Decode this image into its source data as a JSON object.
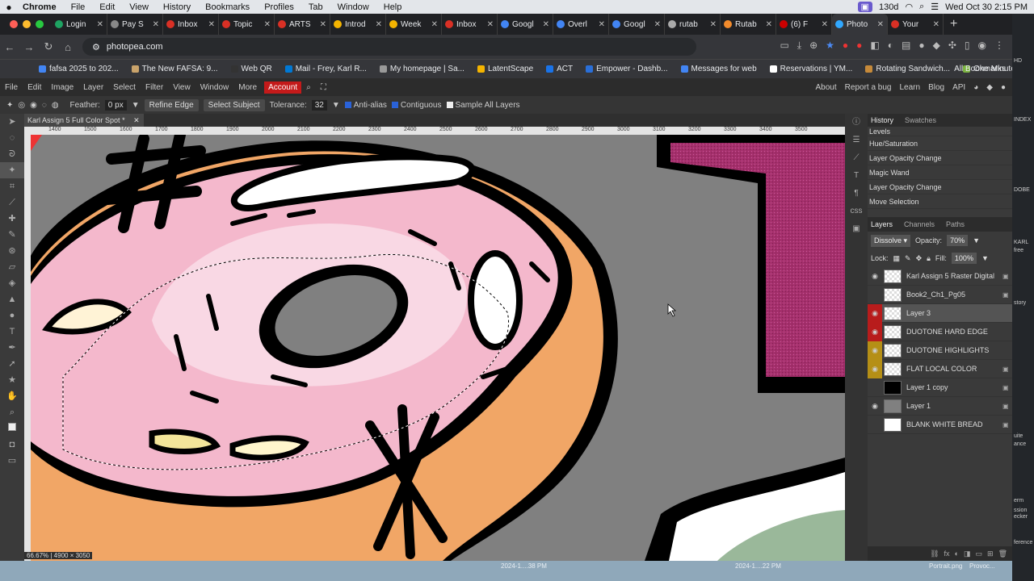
{
  "mac": {
    "apple": "",
    "app": "Chrome",
    "menus": [
      "File",
      "Edit",
      "View",
      "History",
      "Bookmarks",
      "Profiles",
      "Tab",
      "Window",
      "Help"
    ],
    "battery": "130d",
    "datetime": "Wed Oct 30  2:15 PM"
  },
  "tabs": [
    "Login",
    "Pay S",
    "Inbox",
    "Topic",
    "ARTS",
    "Introd",
    "Week",
    "Inbox",
    "Googl",
    "Overl",
    "Googl",
    "rutab",
    "Rutab",
    "(6) F",
    "Photo",
    "Your"
  ],
  "tab_colors": [
    "#1ea362",
    "#888",
    "#d93025",
    "#d93025",
    "#d93025",
    "#f4b400",
    "#f4b400",
    "#d93025",
    "#4285f4",
    "#4285f4",
    "#4285f4",
    "#aaa",
    "#f28b2c",
    "#cc0000",
    "#31a8ff",
    "#d93025"
  ],
  "url": "photopea.com",
  "bookmarks": [
    "fafsa 2025 to 202...",
    "The New FAFSA: 9...",
    "Web QR",
    "Mail - Frey, Karl R...",
    "My homepage | Sa...",
    "LatentScape",
    "ACT",
    "Empower - Dashb...",
    "Messages for web",
    "Reservations | YM...",
    "Rotating Sandwich...",
    "One Minute Park"
  ],
  "all_bookmarks": "All Bookmarks",
  "photopea": {
    "menu": [
      "File",
      "Edit",
      "Image",
      "Layer",
      "Select",
      "Filter",
      "View",
      "Window",
      "More"
    ],
    "account": "Account",
    "right_links": [
      "About",
      "Report a bug",
      "Learn",
      "Blog",
      "API"
    ],
    "options": {
      "feather_label": "Feather:",
      "feather_value": "0 px",
      "refine_edge": "Refine Edge",
      "select_subject": "Select Subject",
      "tolerance_label": "Tolerance:",
      "tolerance_value": "32",
      "anti_alias": "Anti-alias",
      "contiguous": "Contiguous",
      "sample_all": "Sample All Layers"
    },
    "doc_tab": "Karl Assign 5 Full Color Spot",
    "doc_tab_mod": "*",
    "ruler_ticks": [
      "1400",
      "1500",
      "1600",
      "1700",
      "1800",
      "1900",
      "2000",
      "2100",
      "2200",
      "2300",
      "2400",
      "2500",
      "2600",
      "2700",
      "2800",
      "2900",
      "3000",
      "3100",
      "3200",
      "3300",
      "3400",
      "3500"
    ],
    "zoom": "66.67%",
    "dims": "4900 × 3050",
    "history_tab": "History",
    "swatches_tab": "Swatches",
    "history": [
      "Levels",
      "Hue/Saturation",
      "Layer Opacity Change",
      "Magic Wand",
      "Layer Opacity Change",
      "Move Selection"
    ],
    "layer_tabs": [
      "Layers",
      "Channels",
      "Paths"
    ],
    "blend_mode": "Dissolve",
    "opacity_label": "Opacity:",
    "opacity_value": "70%",
    "lock_label": "Lock:",
    "fill_label": "Fill:",
    "fill_value": "100%",
    "layers": [
      {
        "name": "Karl Assign 5 Raster Digital",
        "visible": true,
        "color": "",
        "locked": true
      },
      {
        "name": "Book2_Ch1_Pg05",
        "visible": false,
        "color": "",
        "locked": true
      },
      {
        "name": "Layer 3",
        "visible": true,
        "color": "#b81c1c",
        "locked": false
      },
      {
        "name": "DUOTONE HARD EDGE",
        "visible": true,
        "color": "#b81c1c",
        "locked": false
      },
      {
        "name": "DUOTONE HIGHLIGHTS",
        "visible": true,
        "color": "#b58f16",
        "locked": false
      },
      {
        "name": "FLAT LOCAL COLOR",
        "visible": true,
        "color": "#b58f16",
        "locked": true
      },
      {
        "name": "Layer 1 copy",
        "visible": false,
        "color": "",
        "locked": true
      },
      {
        "name": "Layer 1",
        "visible": true,
        "color": "",
        "locked": true
      },
      {
        "name": "BLANK WHITE BREAD",
        "visible": false,
        "color": "",
        "locked": true
      }
    ]
  },
  "desktop_labels": [
    "HD",
    "INDEX",
    "DOBE",
    "KARL",
    "free",
    "story",
    "uite",
    "ance",
    "erm",
    "ssion",
    "ecker",
    "ference"
  ],
  "dock_labels": [
    "2024-1....38 PM",
    "2024-1....22 PM",
    "Portrait.png",
    "Provoc..."
  ]
}
